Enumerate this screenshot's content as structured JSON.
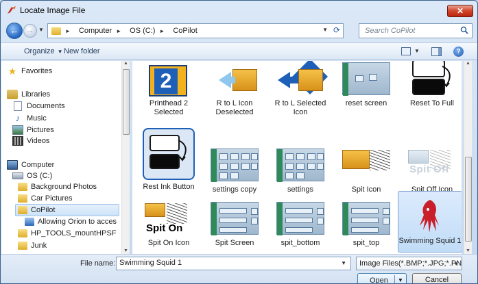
{
  "window": {
    "title": "Locate Image File",
    "close_label": "✕"
  },
  "navbar": {
    "breadcrumb": [
      "Computer",
      "OS (C:)",
      "CoPilot"
    ],
    "search_placeholder": "Search CoPilot"
  },
  "toolbar": {
    "organize_label": "Organize",
    "new_folder_label": "New folder"
  },
  "sidebar": {
    "items": [
      {
        "label": "Favorites",
        "icon": "star-icon"
      },
      {
        "label": "Libraries",
        "icon": "libraries-icon"
      },
      {
        "label": "Documents",
        "icon": "documents-icon"
      },
      {
        "label": "Music",
        "icon": "music-icon"
      },
      {
        "label": "Pictures",
        "icon": "pictures-icon"
      },
      {
        "label": "Videos",
        "icon": "videos-icon"
      },
      {
        "label": "Computer",
        "icon": "computer-icon"
      },
      {
        "label": "OS (C:)",
        "icon": "drive-icon"
      },
      {
        "label": "Background Photos",
        "icon": "folder-icon"
      },
      {
        "label": "Car Pictures",
        "icon": "folder-icon"
      },
      {
        "label": "CoPilot",
        "icon": "folder-icon"
      },
      {
        "label": "Allowing Orion to acces",
        "icon": "shortcut-icon"
      },
      {
        "label": "HP_TOOLS_mountHPSF",
        "icon": "folder-icon"
      },
      {
        "label": "Junk",
        "icon": "folder-icon"
      }
    ]
  },
  "files": [
    {
      "label": "Printhead 2 Selected",
      "thumb": "printhead-icon"
    },
    {
      "label": "R to L Icon Deselected",
      "thumb": "arrow-box-icon"
    },
    {
      "label": "R to L Selected Icon",
      "thumb": "arrow-box-selected-icon"
    },
    {
      "label": "reset screen",
      "thumb": "screen-icon"
    },
    {
      "label": "Reset To Full",
      "thumb": "reset-icon"
    },
    {
      "label": "Rest Ink Button",
      "thumb": "reset-icon"
    },
    {
      "label": "settings copy",
      "thumb": "settings-icon"
    },
    {
      "label": "settings",
      "thumb": "settings-icon"
    },
    {
      "label": "Spit Icon",
      "thumb": "spit-icon"
    },
    {
      "label": "Spit Off Icon",
      "thumb": "spit-off-icon",
      "thumb_text": "Spit Off"
    },
    {
      "label": "Spit On Icon",
      "thumb": "spit-on-icon",
      "thumb_text": "Spit On"
    },
    {
      "label": "Spit Screen",
      "thumb": "screen-icon"
    },
    {
      "label": "spit_bottom",
      "thumb": "screen-icon"
    },
    {
      "label": "spit_top",
      "thumb": "screen-icon"
    },
    {
      "label": "Swimming Squid 1",
      "thumb": "squid-icon",
      "selected": true
    }
  ],
  "printhead_number": "2",
  "bottom": {
    "filename_label": "File name:",
    "filename_value": "Swimming Squid 1",
    "filter_value": "Image Files(*.BMP;*.JPG;*.PNG;",
    "open_label": "Open",
    "cancel_label": "Cancel"
  },
  "colors": {
    "accent": "#1e5fb8",
    "selection": "#c1dcf8"
  }
}
